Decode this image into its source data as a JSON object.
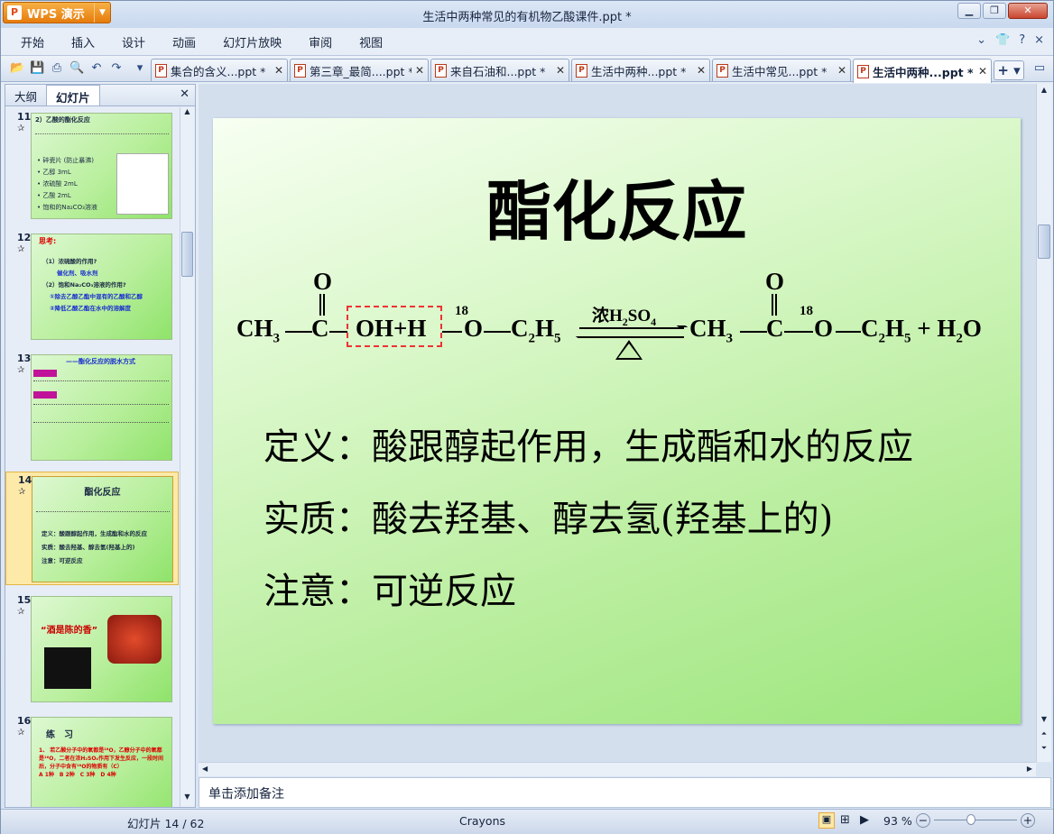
{
  "app": {
    "button": "WPS 演示",
    "title": "生活中两种常见的有机物乙酸课件.ppt *"
  },
  "menu": [
    "开始",
    "插入",
    "设计",
    "动画",
    "幻灯片放映",
    "审阅",
    "视图"
  ],
  "tabs": [
    {
      "label": "集合的含义...ppt *",
      "active": false
    },
    {
      "label": "第三章_最简....ppt *",
      "active": false
    },
    {
      "label": "来自石油和...ppt *",
      "active": false
    },
    {
      "label": "生活中两种...ppt *",
      "active": false
    },
    {
      "label": "生活中常见...ppt *",
      "active": false
    },
    {
      "label": "生活中两种...ppt *",
      "active": true
    }
  ],
  "left_panel": {
    "tab_outline": "大纲",
    "tab_slides": "幻灯片"
  },
  "thumbnails": [
    {
      "num": "11",
      "title": "2）乙酸的酯化反应",
      "lines": [
        "• 碎瓷片 (防止暴沸)",
        "• 乙醇 3mL",
        "• 浓硫酸 2mL",
        "• 乙酸 2mL",
        "• 饱和的Na₂CO₃溶液"
      ]
    },
    {
      "num": "12",
      "title": "思考:",
      "lines": [
        "（1）浓硫酸的作用?",
        "催化剂、吸水剂",
        "（2）饱和Na₂CO₃溶液的作用?",
        "①除去乙酸乙酯中混有的乙酸和乙醇",
        "②降低乙酸乙酯在水中的溶解度"
      ]
    },
    {
      "num": "13",
      "title": "——酯化反应的脱水方式",
      "lines": []
    },
    {
      "num": "14",
      "title": "酯化反应",
      "lines": [
        "定义：酸跟醇起作用，生成酯和水的反应",
        "实质：酸去羟基、醇去氢(羟基上的)",
        "注意：可逆反应"
      ]
    },
    {
      "num": "15",
      "title": "“酒是陈的香”",
      "lines": []
    },
    {
      "num": "16",
      "title": "练　习",
      "lines": []
    }
  ],
  "slide": {
    "title": "酯化反应",
    "catalyst": "浓H2SO4",
    "definition": "定义：酸跟醇起作用，生成酯和水的反应",
    "essence": "实质：酸去羟基、醇去氢(羟基上的)",
    "note": "注意：可逆反应"
  },
  "notes_placeholder": "单击添加备注",
  "status": {
    "slide": "幻灯片 14 / 62",
    "theme": "Crayons",
    "zoom": "93 %"
  }
}
